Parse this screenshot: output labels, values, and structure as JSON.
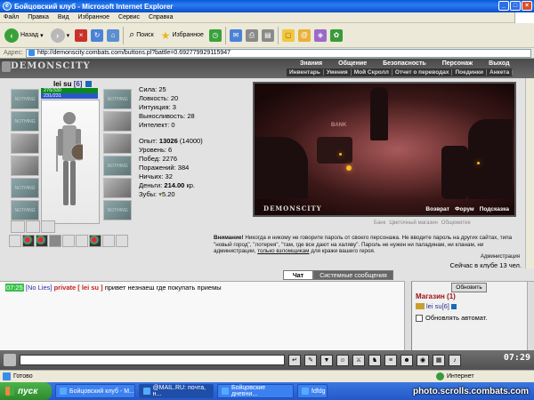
{
  "window": {
    "title": "Бойцовский клуб - Microsoft Internet Explorer"
  },
  "menu": [
    "Файл",
    "Правка",
    "Вид",
    "Избранное",
    "Сервис",
    "Справка"
  ],
  "toolbar": {
    "back_label": "Назад",
    "search_label": "Поиск",
    "favorites_label": "Избранное"
  },
  "address": {
    "label": "Адрес:",
    "url": "http://demonscity.combats.com/buttons.pl?battle=0.692779929115947"
  },
  "game": {
    "logo": "DEMONSCITY",
    "top_nav": [
      "Знания",
      "Общение",
      "Безопасность",
      "Персонаж",
      "Выход"
    ],
    "sub_nav": [
      "Инвентарь",
      "Умения",
      "Мой Скролл",
      "Отчет о переводах",
      "Поединки",
      "Анкета"
    ]
  },
  "character": {
    "name": "lei su",
    "level": "[6]",
    "hp": "276/330",
    "mp": "231/231",
    "slot_placeholder": "NOTHING"
  },
  "stats": {
    "strength": "Сила: 25",
    "agility": "Ловкость: 20",
    "intuition": "Интуиция: 3",
    "endurance": "Выносливость: 28",
    "intellect": "Интелект: 0",
    "exp_label": "Опыт:",
    "exp_value": "13026",
    "exp_next": "(14000)",
    "level_line": "Уровень: 6",
    "wins": "Побед: 2276",
    "losses": "Поражений: 384",
    "draws": "Ничьих: 32",
    "money_label": "Деньги:",
    "money_value": "214.00",
    "money_unit": "кр.",
    "teeth_label": "Зубы:",
    "teeth_value": "5.20"
  },
  "scene": {
    "logo": "DEMONSCITY",
    "bank_label": "BANK",
    "links": [
      "Возврат",
      "Форум",
      "Подсказка"
    ],
    "under_links": [
      "Банк",
      "Цветочный магазин",
      "Общежитие"
    ]
  },
  "warning": {
    "lead": "Внимание!",
    "text": "Никогда и никому не говорите пароль от своего персонажа. Не вводите пароль на других сайтах, типа \"новый город\", \"лотерея\", \"там, где все дают на халяву\". Пароль не нужен ни паладинам, ни кланам, ни администрации,",
    "only_thieves": "только взломщикам",
    "tail": "для кражи вашего героя.",
    "admin": "Администрация"
  },
  "online": "Сейчас в клубе 13 чел.",
  "tabs": {
    "chat": "Чат",
    "system": "Системные сообщения"
  },
  "chat": {
    "time": "07:25",
    "nick1": "[No Lies]",
    "private": "private [ lei su ]",
    "message": "привет незнаеш где покупать приемы"
  },
  "side": {
    "refresh": "Обновить",
    "shop": "Магазин (1)",
    "person": "lei su[6]",
    "auto_refresh": "Обновлять автомат."
  },
  "clock": "07:29",
  "status": {
    "text": "Готово",
    "zone": "Интернет"
  },
  "taskbar": {
    "start": "пуск",
    "tasks": [
      "Бойцовский клуб - M...",
      "@MAIL.RU: почта, н...",
      "Бойцовские дневни...",
      "fdfdg"
    ]
  },
  "watermark": "photo.scrolls.combats.com",
  "colors": {
    "hp_bar": "#0a8a1e",
    "mp_bar": "#2b56c9",
    "private_text": "#c82020",
    "shop_text": "#a01010",
    "chat_time_bg": "#39c14b"
  }
}
